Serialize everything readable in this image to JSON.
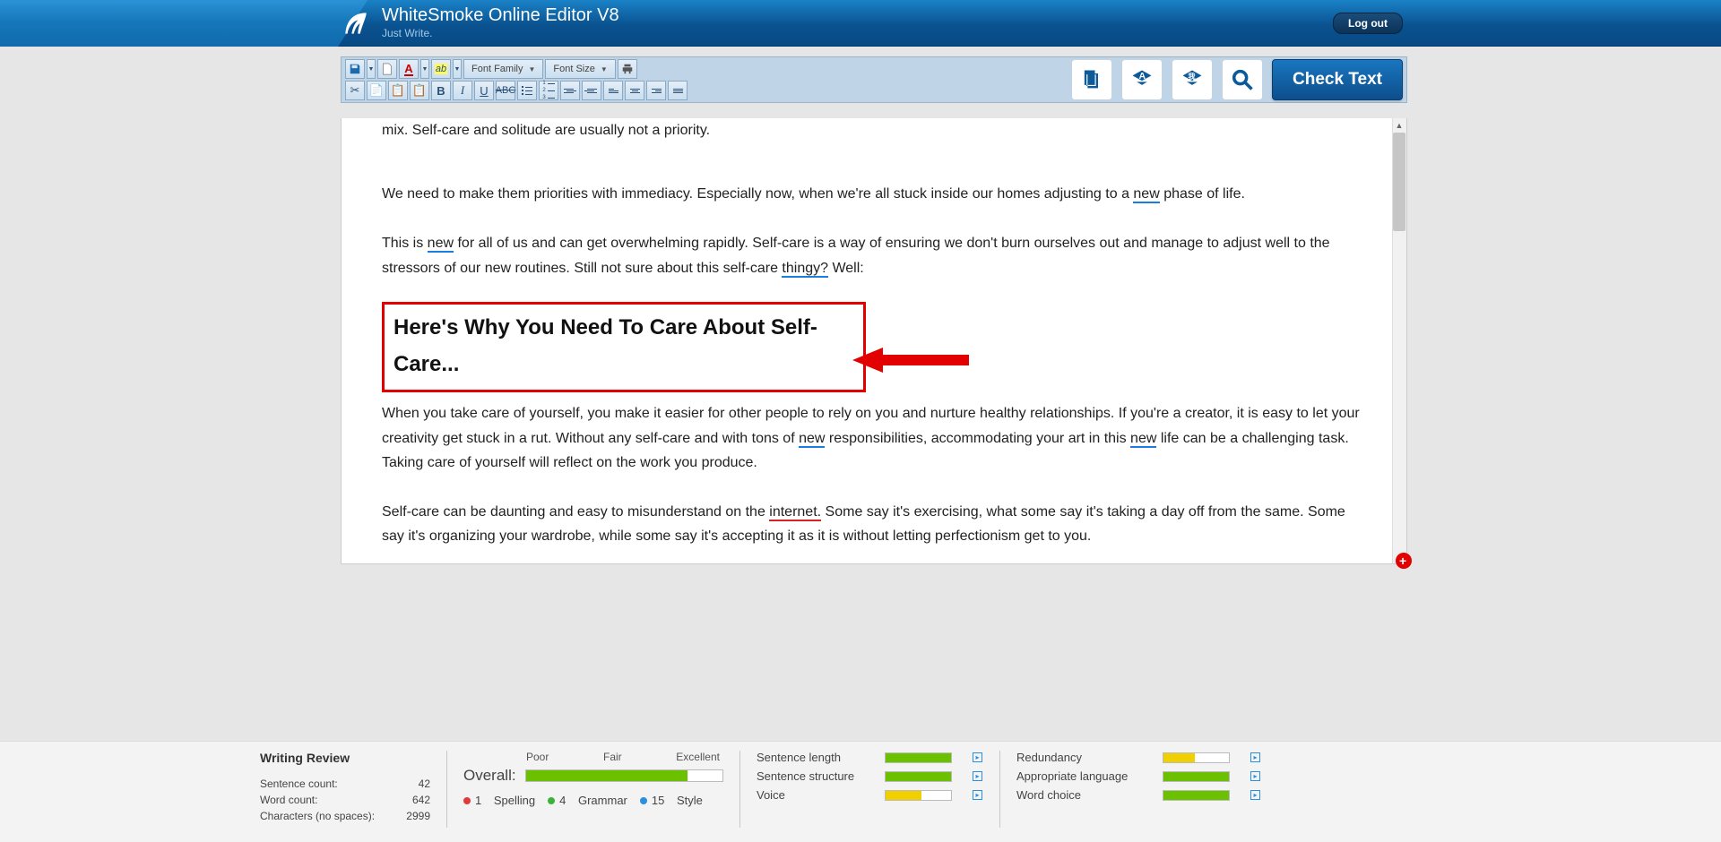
{
  "header": {
    "title": "WhiteSmoke Online Editor V8",
    "tagline": "Just Write.",
    "logout_label": "Log out"
  },
  "toolbar": {
    "font_family_label": "Font Family",
    "font_size_label": "Font Size",
    "check_text_label": "Check Text"
  },
  "content": {
    "cut_line": "mix. Self-care and solitude are usually not a priority.",
    "p1_a": "We need to make them priorities with immediacy. Especially now, when we're all stuck inside our homes adjusting to a ",
    "p1_new": "new",
    "p1_b": " phase of life.",
    "p2_a": "This is ",
    "p2_new": "new",
    "p2_b": " for all of us and can get overwhelming rapidly. Self-care is a way of ensuring we don't burn ourselves out and manage to adjust well to the stressors of our new routines. Still not sure about this self-care ",
    "p2_thingy": "thingy?",
    "p2_c": " Well:",
    "heading": "Here's Why You Need To Care About Self-Care...",
    "p3_a": "When you take care of yourself, you make it easier for other people to rely on you and nurture healthy relationships. If you're a creator, it is easy to let your creativity get stuck in a rut. Without any self-care and with tons of ",
    "p3_new1": "new",
    "p3_b": " responsibilities, accommodating your art in this ",
    "p3_new2": "new",
    "p3_c": " life can be a challenging task. Taking care of yourself will reflect on the work you produce.",
    "p4_a": "Self-care can be daunting and easy to misunderstand on the ",
    "p4_internet": "internet.",
    "p4_b": " Some say it's exercising, what some say it's taking a day off from the same. Some say it's organizing your wardrobe, while some say it's accepting it as it is without letting perfectionism get to you."
  },
  "review": {
    "title": "Writing Review",
    "sentence_count_label": "Sentence count:",
    "sentence_count_value": "42",
    "word_count_label": "Word count:",
    "word_count_value": "642",
    "chars_label": "Characters (no spaces):",
    "chars_value": "2999",
    "overall_label": "Overall:",
    "scale_poor": "Poor",
    "scale_fair": "Fair",
    "scale_excellent": "Excellent",
    "overall_pct": 82,
    "legend_spelling_count": "1",
    "legend_spelling_label": "Spelling",
    "legend_grammar_count": "4",
    "legend_grammar_label": "Grammar",
    "legend_style_count": "15",
    "legend_style_label": "Style",
    "metrics1": [
      {
        "label": "Sentence length",
        "pct": 100,
        "color": "green"
      },
      {
        "label": "Sentence structure",
        "pct": 100,
        "color": "green"
      },
      {
        "label": "Voice",
        "pct": 55,
        "color": "yellow"
      }
    ],
    "metrics2": [
      {
        "label": "Redundancy",
        "pct": 48,
        "color": "yellow"
      },
      {
        "label": "Appropriate language",
        "pct": 100,
        "color": "green"
      },
      {
        "label": "Word choice",
        "pct": 100,
        "color": "green"
      }
    ]
  }
}
